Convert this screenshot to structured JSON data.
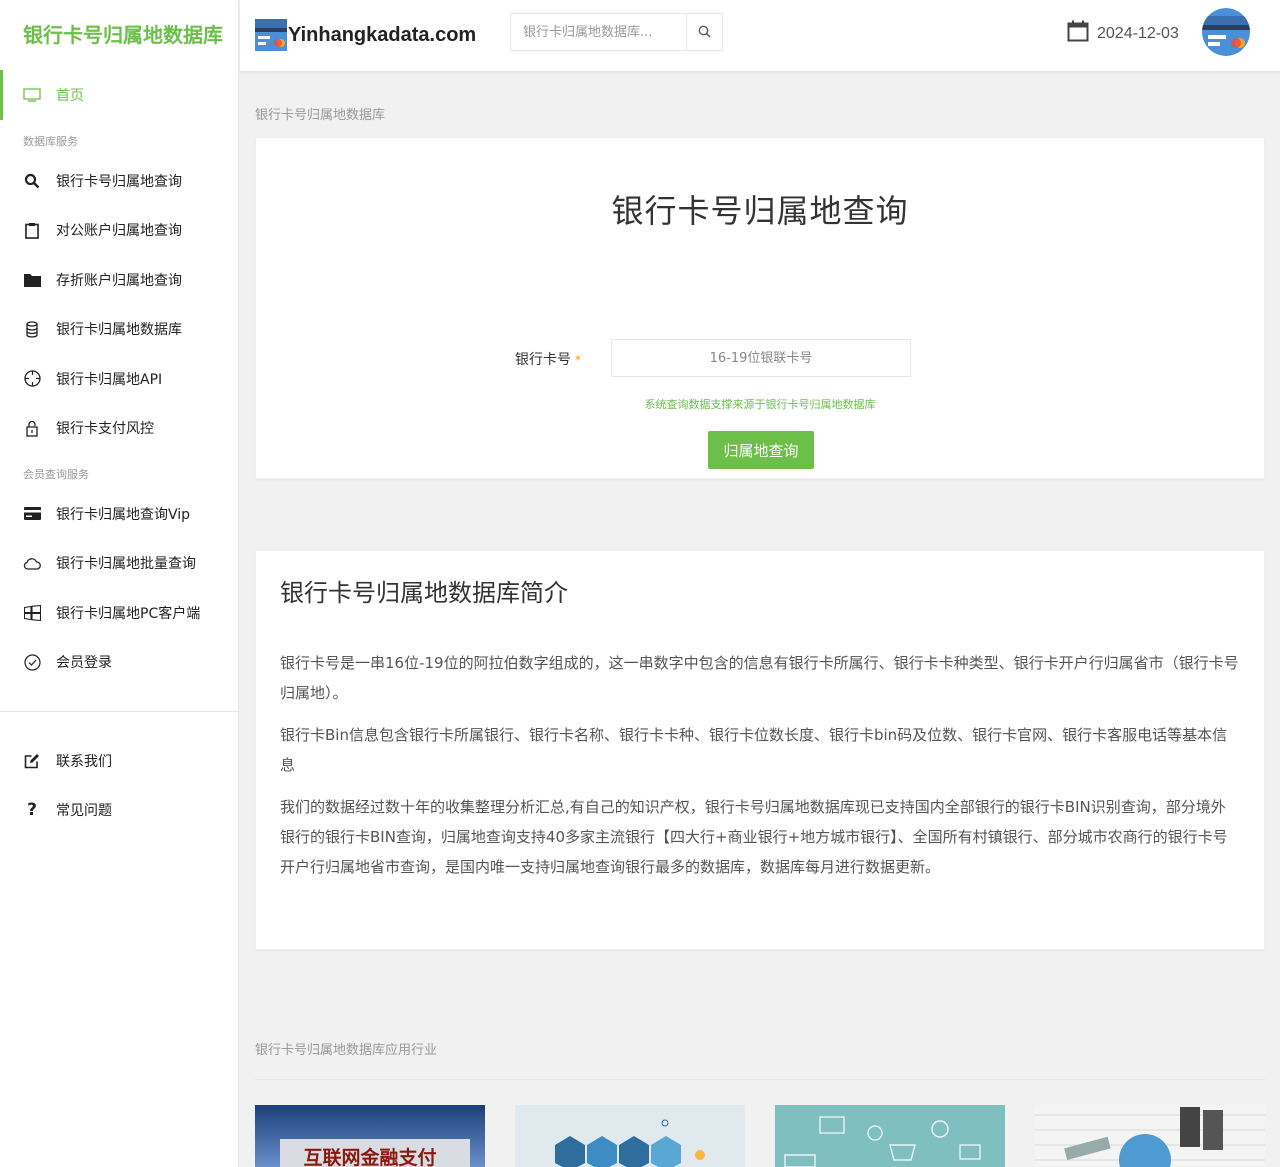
{
  "sidebar": {
    "logo": "银行卡号归属地数据库",
    "home": "首页",
    "group1": "数据库服务",
    "items1": [
      {
        "label": "银行卡号归属地查询",
        "icon": "search-icon"
      },
      {
        "label": "对公账户归属地查询",
        "icon": "clipboard-icon"
      },
      {
        "label": "存折账户归属地查询",
        "icon": "folder-icon"
      },
      {
        "label": "银行卡归属地数据库",
        "icon": "database-icon"
      },
      {
        "label": "银行卡归属地API",
        "icon": "circle-dashed-icon"
      },
      {
        "label": "银行卡支付风控",
        "icon": "lock-icon"
      }
    ],
    "group2": "会员查询服务",
    "items2": [
      {
        "label": "银行卡归属地查询Vip",
        "icon": "credit-card-icon"
      },
      {
        "label": "银行卡归属地批量查询",
        "icon": "cloud-icon"
      },
      {
        "label": "银行卡归属地PC客户端",
        "icon": "windows-icon"
      },
      {
        "label": "会员登录",
        "icon": "check-circle-icon"
      }
    ],
    "items3": [
      {
        "label": "联系我们",
        "icon": "edit-icon"
      },
      {
        "label": "常见问题",
        "icon": "question-icon"
      }
    ]
  },
  "header": {
    "brand": "Yinhangkadata.com",
    "search_placeholder": "银行卡归属地数据库...",
    "date": "2024-12-03"
  },
  "main": {
    "breadcrumb": "银行卡号归属地数据库",
    "query": {
      "title": "银行卡号归属地查询",
      "label": "银行卡号",
      "required_mark": "*",
      "input_placeholder": "16-19位银联卡号",
      "hint": "系统查询数据支撑来源于银行卡号归属地数据库",
      "button": "归属地查询"
    },
    "intro": {
      "title": "银行卡号归属地数据库简介",
      "p1": "银行卡号是一串16位-19位的阿拉伯数字组成的，这一串数字中包含的信息有银行卡所属行、银行卡卡种类型、银行卡开户行归属省市（银行卡号归属地）。",
      "p2": "银行卡Bin信息包含银行卡所属银行、银行卡名称、银行卡卡种、银行卡位数长度、银行卡bin码及位数、银行卡官网、银行卡客服电话等基本信息",
      "p3": "我们的数据经过数十年的收集整理分析汇总,有自己的知识产权，银行卡号归属地数据库现已支持国内全部银行的银行卡BIN识别查询，部分境外银行的银行卡BIN查询，归属地查询支持40多家主流银行【四大行+商业银行+地方城市银行】、全国所有村镇银行、部分城市农商行的银行卡号开户行归属地省市查询，是国内唯一支持归属地查询银行最多的数据库，数据库每月进行数据更新。"
    },
    "apps_title": "银行卡号归属地数据库应用行业",
    "app1_caption": "互联网金融支付"
  },
  "colors": {
    "accent": "#6cc04a",
    "sidebar_bg": "#ffffff",
    "page_bg": "#f1f1f1"
  }
}
